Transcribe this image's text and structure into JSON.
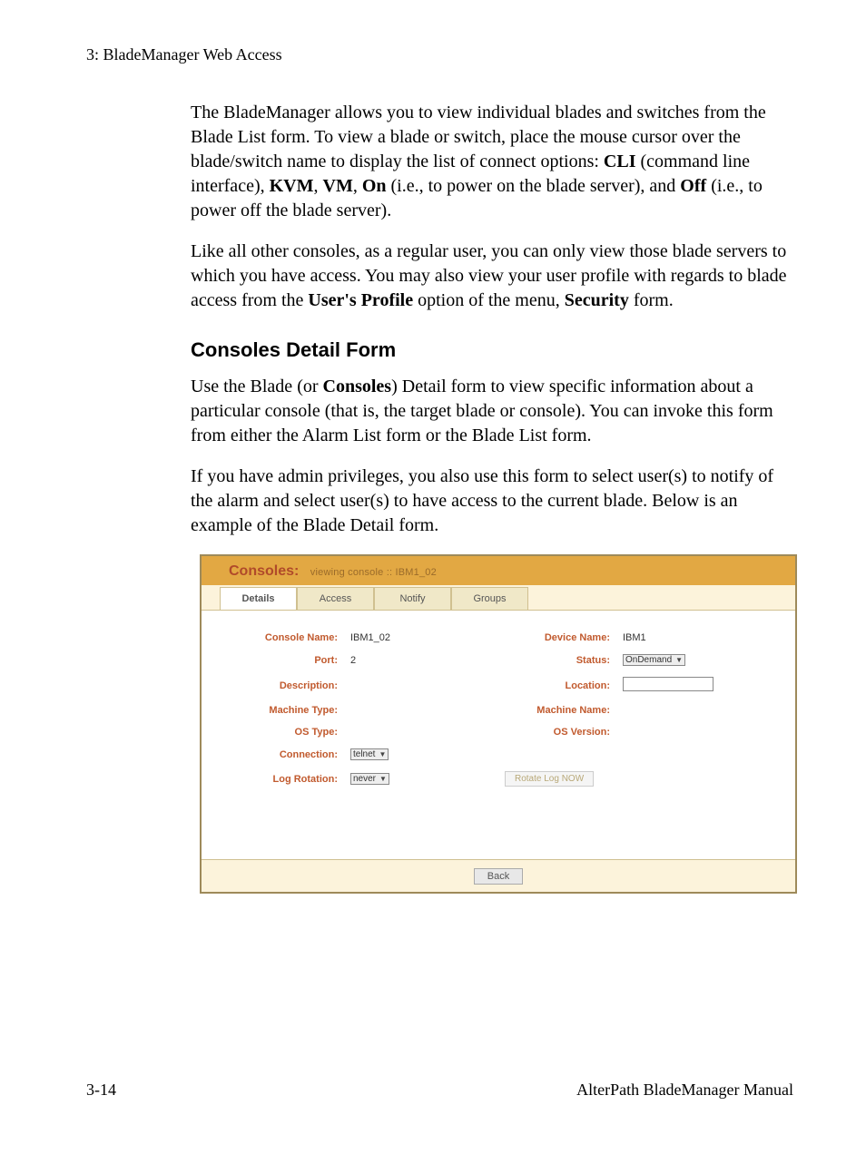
{
  "header": "3: BladeManager Web Access",
  "para1_a": "The BladeManager allows you to view individual blades and switches from the Blade List form. To view a blade or switch, place the mouse cursor over the blade/switch name to display the list of connect options: ",
  "para1_cli": "CLI",
  "para1_b": " (command line interface), ",
  "para1_kvm": "KVM",
  "para1_c": ", ",
  "para1_vm": "VM",
  "para1_d": ", ",
  "para1_on": "On",
  "para1_e": " (i.e., to power on the blade server), and ",
  "para1_off": "Off",
  "para1_f": " (i.e., to power off the blade server).",
  "para2_a": "Like all other consoles, as a regular user, you can only view those blade servers to which you have access. You may also view your user profile with regards to blade access from the ",
  "para2_up": "User's Profile",
  "para2_b": " option of the menu, ",
  "para2_sec": "Security",
  "para2_c": " form.",
  "section_heading": "Consoles Detail Form",
  "para3_a": "Use the Blade (or ",
  "para3_con": "Consoles",
  "para3_b": ") Detail form to view specific information about a particular console (that is, the target blade or console). You can invoke this form from either the Alarm List form or the Blade List form.",
  "para4": "If you have admin privileges, you also use this form to select user(s) to notify of the alarm and select user(s) to have access to the current blade. Below is an example of the Blade Detail form.",
  "screenshot": {
    "title": "Consoles:",
    "subtitle": "viewing console  ::  IBM1_02",
    "tabs": {
      "details": "Details",
      "access": "Access",
      "notify": "Notify",
      "groups": "Groups"
    },
    "labels": {
      "console_name": "Console Name:",
      "device_name": "Device Name:",
      "port": "Port:",
      "status": "Status:",
      "description": "Description:",
      "location": "Location:",
      "machine_type": "Machine Type:",
      "machine_name": "Machine Name:",
      "os_type": "OS Type:",
      "os_version": "OS Version:",
      "connection": "Connection:",
      "log_rotation": "Log Rotation:"
    },
    "values": {
      "console_name": "IBM1_02",
      "device_name": "IBM1",
      "port": "2",
      "status": "OnDemand",
      "connection": "telnet",
      "log_rotation": "never"
    },
    "rotate_btn": "Rotate Log NOW",
    "back_btn": "Back"
  },
  "footer": {
    "left": "3-14",
    "right": "AlterPath BladeManager Manual"
  }
}
